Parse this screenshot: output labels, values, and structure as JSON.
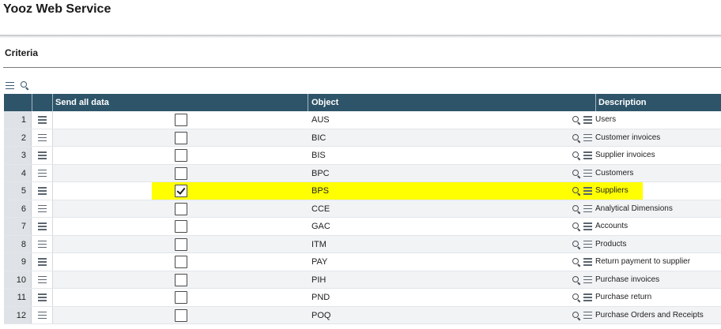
{
  "app": {
    "title": "Yooz Web Service"
  },
  "section": {
    "title": "Criteria"
  },
  "toolbar": {
    "icons": [
      "menu-icon",
      "search-icon"
    ]
  },
  "table": {
    "columns": [
      "Send all data",
      "Object",
      "Description"
    ],
    "rows": [
      {
        "num": "1",
        "checked": false,
        "object": "AUS",
        "description": "Users"
      },
      {
        "num": "2",
        "checked": false,
        "object": "BIC",
        "description": "Customer invoices"
      },
      {
        "num": "3",
        "checked": false,
        "object": "BIS",
        "description": "Supplier invoices"
      },
      {
        "num": "4",
        "checked": false,
        "object": "BPC",
        "description": "Customers"
      },
      {
        "num": "5",
        "checked": true,
        "object": "BPS",
        "description": "Suppliers",
        "highlighted": true
      },
      {
        "num": "6",
        "checked": false,
        "object": "CCE",
        "description": "Analytical Dimensions"
      },
      {
        "num": "7",
        "checked": false,
        "object": "GAC",
        "description": "Accounts"
      },
      {
        "num": "8",
        "checked": false,
        "object": "ITM",
        "description": "Products"
      },
      {
        "num": "9",
        "checked": false,
        "object": "PAY",
        "description": "Return payment to supplier"
      },
      {
        "num": "10",
        "checked": false,
        "object": "PIH",
        "description": "Purchase invoices"
      },
      {
        "num": "11",
        "checked": false,
        "object": "PND",
        "description": "Purchase return"
      },
      {
        "num": "12",
        "checked": false,
        "object": "POQ",
        "description": "Purchase Orders and Receipts"
      }
    ]
  },
  "colors": {
    "header_bg": "#2e5469",
    "highlight": "#ffff00",
    "row_alt": "#f1f3f5"
  }
}
